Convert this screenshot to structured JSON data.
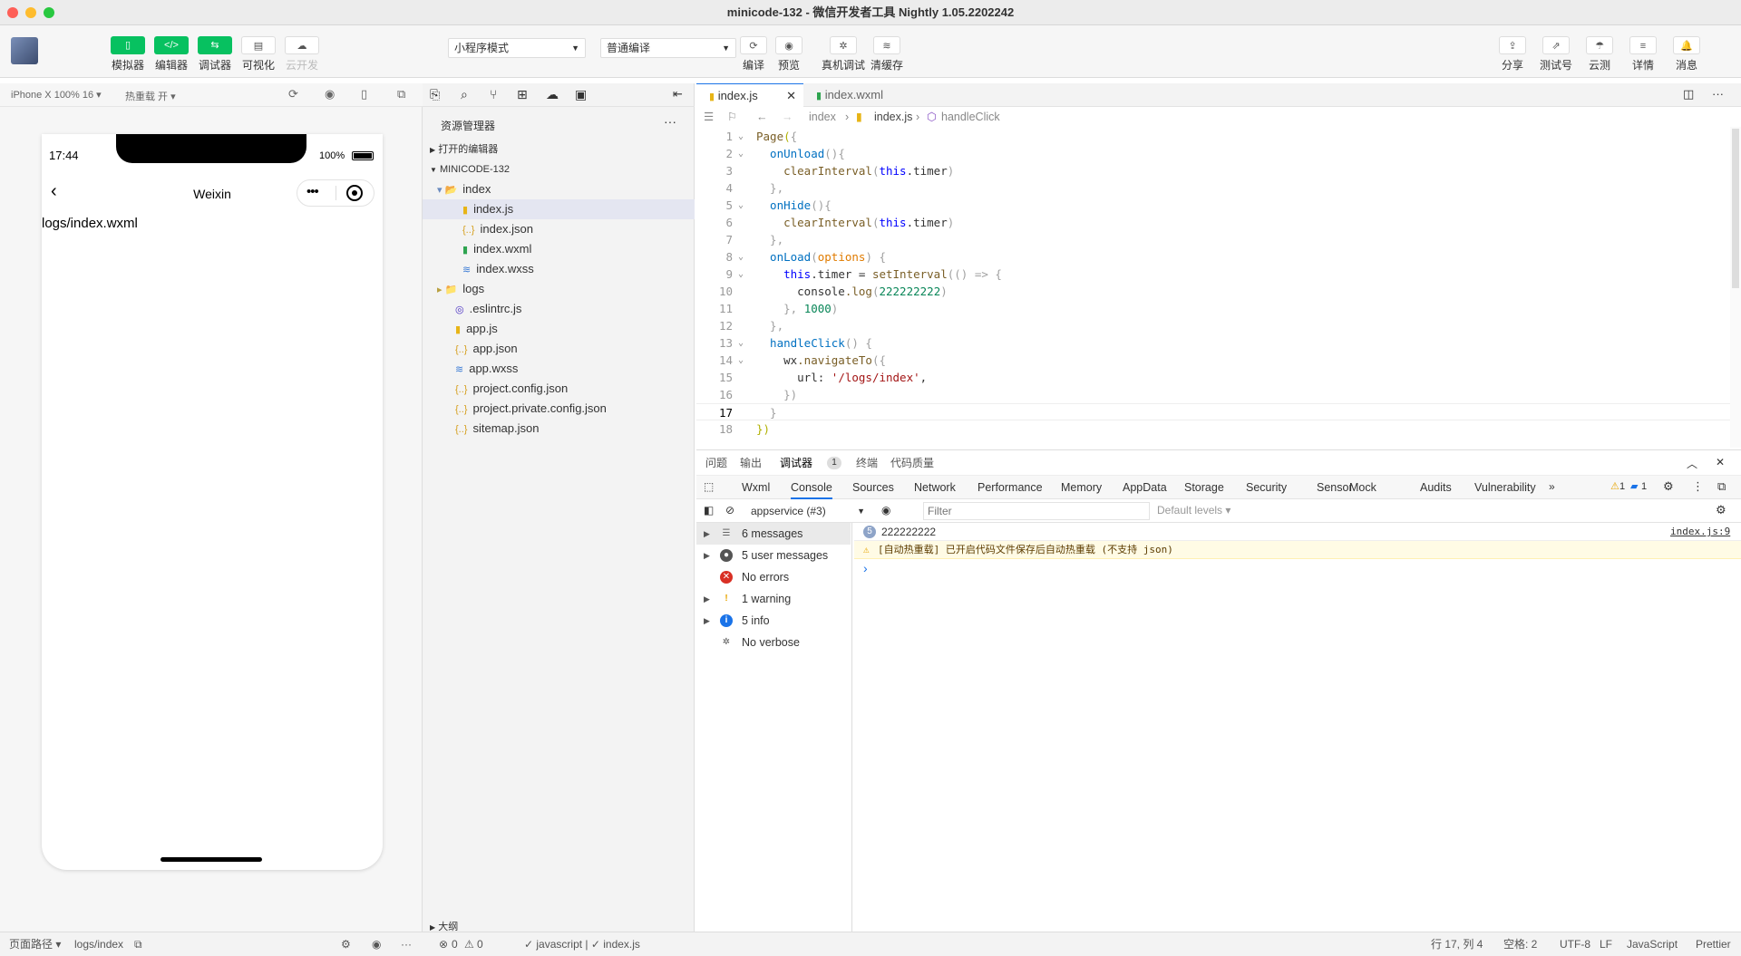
{
  "window": {
    "title": "minicode-132 - 微信开发者工具 Nightly 1.05.2202242"
  },
  "toolbar": {
    "left_buttons": [
      {
        "label": "模拟器",
        "icon": "phone-icon"
      },
      {
        "label": "编辑器",
        "icon": "code-icon"
      },
      {
        "label": "调试器",
        "icon": "debug-icon"
      },
      {
        "label": "可视化",
        "icon": "layout-icon"
      },
      {
        "label": "云开发",
        "icon": "cloud-icon"
      }
    ],
    "mode_select": "小程序模式",
    "compile_select": "普通编译",
    "mid_buttons": [
      {
        "label": "编译",
        "icon": "refresh-icon"
      },
      {
        "label": "预览",
        "icon": "eye-icon"
      },
      {
        "label": "真机调试",
        "icon": "bug-icon"
      },
      {
        "label": "清缓存",
        "icon": "layers-icon"
      }
    ],
    "right_buttons": [
      {
        "label": "分享",
        "icon": "share-icon"
      },
      {
        "label": "测试号",
        "icon": "external-icon"
      },
      {
        "label": "云测",
        "icon": "cloud-test-icon"
      },
      {
        "label": "详情",
        "icon": "menu-icon"
      },
      {
        "label": "消息",
        "icon": "bell-icon"
      }
    ]
  },
  "simulator": {
    "device": "iPhone X 100% 16 ▾",
    "hot_reload": "热重载 开 ▾",
    "time": "17:44",
    "battery": "100%",
    "nav_title": "Weixin",
    "page_text": "logs/index.wxml"
  },
  "explorer": {
    "title": "资源管理器",
    "open_editors": "打开的编辑器",
    "project": "MINICODE-132",
    "outline": "大纲",
    "files": [
      {
        "name": "index",
        "type": "folder-open",
        "depth": 1
      },
      {
        "name": "index.js",
        "type": "js",
        "depth": 2,
        "selected": true
      },
      {
        "name": "index.json",
        "type": "json",
        "depth": 2
      },
      {
        "name": "index.wxml",
        "type": "wxml",
        "depth": 2
      },
      {
        "name": "index.wxss",
        "type": "wxss",
        "depth": 2
      },
      {
        "name": "logs",
        "type": "folder",
        "depth": 1
      },
      {
        "name": ".eslintrc.js",
        "type": "eslint",
        "depth": 1
      },
      {
        "name": "app.js",
        "type": "js",
        "depth": 1
      },
      {
        "name": "app.json",
        "type": "json",
        "depth": 1
      },
      {
        "name": "app.wxss",
        "type": "wxss",
        "depth": 1
      },
      {
        "name": "project.config.json",
        "type": "json",
        "depth": 1
      },
      {
        "name": "project.private.config.json",
        "type": "json",
        "depth": 1
      },
      {
        "name": "sitemap.json",
        "type": "json",
        "depth": 1
      }
    ]
  },
  "editor": {
    "tabs": [
      "index.js",
      "index.wxml"
    ],
    "breadcrumb": [
      "index",
      "index.js",
      "handleClick"
    ],
    "code": [
      [
        [
          "Page",
          "f"
        ],
        [
          "(",
          "b"
        ],
        [
          "{",
          "p"
        ]
      ],
      [
        [
          "  onUnload",
          "v"
        ],
        [
          "()",
          "p"
        ],
        [
          "{",
          "p"
        ]
      ],
      [
        [
          "    clearInterval",
          "f"
        ],
        [
          "(",
          "p"
        ],
        [
          "this",
          "k"
        ],
        [
          ".timer",
          "d"
        ],
        [
          ")",
          "p"
        ]
      ],
      [
        [
          "  },",
          "p"
        ]
      ],
      [
        [
          "  onHide",
          "v"
        ],
        [
          "()",
          "p"
        ],
        [
          "{",
          "p"
        ]
      ],
      [
        [
          "    clearInterval",
          "f"
        ],
        [
          "(",
          "p"
        ],
        [
          "this",
          "k"
        ],
        [
          ".timer",
          "d"
        ],
        [
          ")",
          "p"
        ]
      ],
      [
        [
          "  },",
          "p"
        ]
      ],
      [
        [
          "  onLoad",
          "v"
        ],
        [
          "(",
          "p"
        ],
        [
          "options",
          "o"
        ],
        [
          ") {",
          "p"
        ]
      ],
      [
        [
          "    this",
          "k"
        ],
        [
          ".timer = ",
          "d"
        ],
        [
          "setInterval",
          "f"
        ],
        [
          "(() => {",
          "p"
        ]
      ],
      [
        [
          "      console",
          "d"
        ],
        [
          ".log",
          "f"
        ],
        [
          "(",
          "p"
        ],
        [
          "222222222",
          "n"
        ],
        [
          ")",
          "p"
        ]
      ],
      [
        [
          "    }, ",
          "p"
        ],
        [
          "1000",
          "n"
        ],
        [
          ")",
          "p"
        ]
      ],
      [
        [
          "  },",
          "p"
        ]
      ],
      [
        [
          "  handleClick",
          "v"
        ],
        [
          "() {",
          "p"
        ]
      ],
      [
        [
          "    wx",
          "d"
        ],
        [
          ".navigateTo",
          "f"
        ],
        [
          "({",
          "p"
        ]
      ],
      [
        [
          "      url: ",
          "d"
        ],
        [
          "'/logs/index'",
          "s"
        ],
        [
          ",",
          "d"
        ]
      ],
      [
        [
          "    })",
          "p"
        ]
      ],
      [
        [
          "  }",
          "p"
        ]
      ],
      [
        [
          "})",
          "b"
        ]
      ]
    ]
  },
  "panel": {
    "tabs": [
      "问题",
      "输出",
      "调试器",
      "终端",
      "代码质量"
    ],
    "debugger_badge": "1",
    "devtools_tabs": [
      "Wxml",
      "Console",
      "Sources",
      "Network",
      "Performance",
      "Memory",
      "AppData",
      "Storage",
      "Security",
      "Sensor",
      "Mock",
      "Audits",
      "Vulnerability"
    ],
    "warn_count": "1",
    "info_count": "1",
    "context": "appservice (#3)",
    "filter_placeholder": "Filter",
    "levels": "Default levels ▾",
    "sidebar": [
      {
        "label": "6 messages",
        "icon": "list-icon",
        "arrow": true
      },
      {
        "label": "5 user messages",
        "icon": "user-icon",
        "arrow": true
      },
      {
        "label": "No errors",
        "icon": "error-icon",
        "arrow": false
      },
      {
        "label": "1 warning",
        "icon": "warning-icon",
        "arrow": true
      },
      {
        "label": "5 info",
        "icon": "info-icon",
        "arrow": true
      },
      {
        "label": "No verbose",
        "icon": "verbose-icon",
        "arrow": false
      }
    ],
    "log_count": "5",
    "log_value": "222222222",
    "log_source": "index.js:9",
    "warning_text": "[自动热重载] 已开启代码文件保存后自动热重载 (不支持 json)",
    "prompt": "›"
  },
  "statusbar": {
    "page_path_label": "页面路径 ▾",
    "page_path": "logs/index",
    "errors": "0",
    "warnings": "0",
    "lang_info": "✓ javascript | ✓ index.js",
    "cursor": "行 17, 列 4",
    "spaces": "空格: 2",
    "encoding": "UTF-8",
    "eol": "LF",
    "language": "JavaScript",
    "formatter": "Prettier"
  },
  "colors": {
    "accent": "#07c160",
    "selection": "#e4e6f1",
    "warning_bg": "#fffbe5",
    "link": "#1a73e8"
  }
}
